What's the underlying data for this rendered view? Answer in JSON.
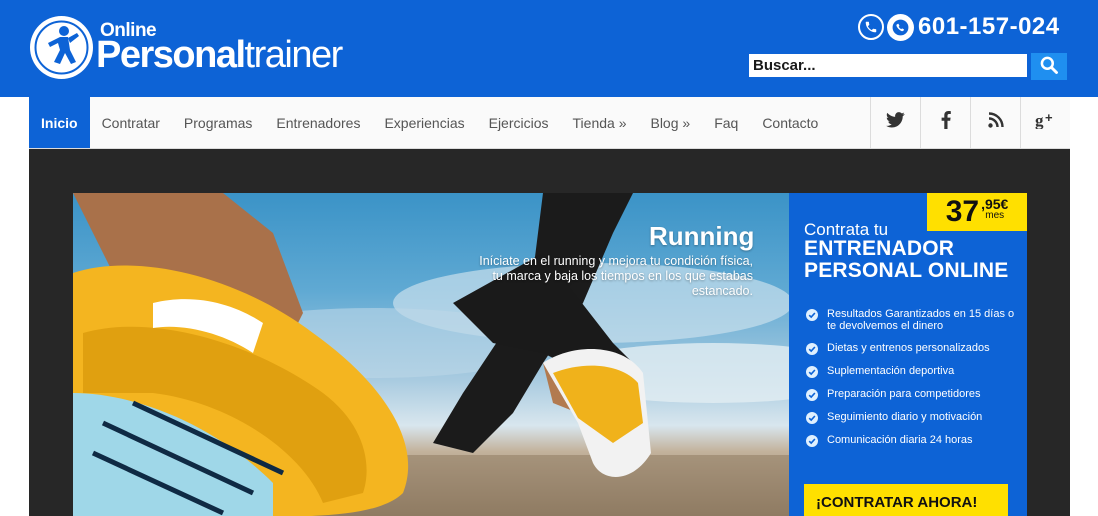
{
  "header": {
    "logo_online": "Online",
    "logo_brand_bold": "Personal",
    "logo_brand_light": "trainer",
    "phone_number": "601-157-024",
    "search_placeholder": "Buscar..."
  },
  "nav": {
    "items": [
      {
        "label": "Inicio",
        "active": true
      },
      {
        "label": "Contratar"
      },
      {
        "label": "Programas"
      },
      {
        "label": "Entrenadores"
      },
      {
        "label": "Experiencias"
      },
      {
        "label": "Ejercicios"
      },
      {
        "label": "Tienda »"
      },
      {
        "label": "Blog »"
      },
      {
        "label": "Faq"
      },
      {
        "label": "Contacto"
      }
    ],
    "social": [
      {
        "icon": "twitter-icon",
        "glyph": "🐦"
      },
      {
        "icon": "facebook-icon",
        "glyph": "f"
      },
      {
        "icon": "rss-icon",
        "glyph": "))"
      },
      {
        "icon": "google-plus-icon",
        "glyph": "g+"
      }
    ]
  },
  "hero": {
    "title": "Running",
    "text": "Iníciate en el running y mejora tu condición física, tu marca y baja los tiempos en los que estabas estancado."
  },
  "promo": {
    "price_main": "37",
    "price_cents": ",95€",
    "price_period": "mes",
    "pre_title": "Contrata tu",
    "title": "ENTRENADOR PERSONAL ONLINE",
    "features": [
      "Resultados Garantizados en 15 días o te devolvemos el dinero",
      "Dietas y entrenos personalizados",
      "Suplementación deportiva",
      "Preparación para competidores",
      "Seguimiento diario y motivación",
      "Comunicación diaria 24 horas"
    ],
    "cta": "¡CONTRATAR AHORA!"
  },
  "colors": {
    "brand_blue": "#0d63d6",
    "accent_yellow": "#ffe000",
    "dark_bg": "#272727"
  }
}
